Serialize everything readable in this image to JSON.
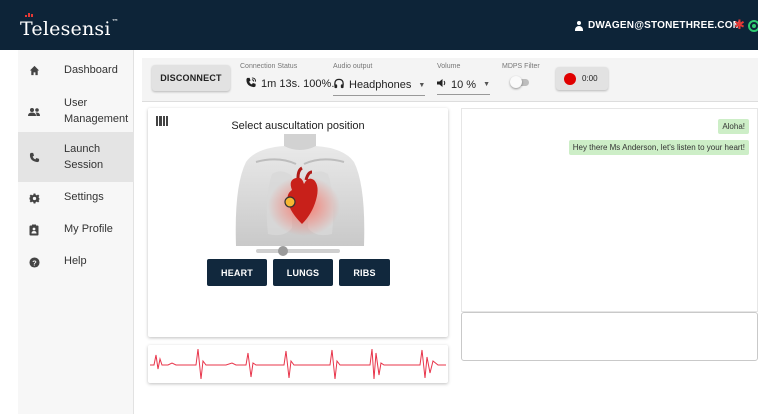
{
  "header": {
    "logo": "Telesensi",
    "trademark": "™",
    "user_email": "DWAGEN@STONETHREE.COM",
    "colors": {
      "bar": "#0d2438",
      "bluetooth": "#e53935",
      "connected": "#2ecc71"
    }
  },
  "sidebar": {
    "items": [
      {
        "label": "Dashboard",
        "icon": "home-icon"
      },
      {
        "label": "User",
        "label2": "Management",
        "icon": "users-icon"
      },
      {
        "label": "Launch",
        "label2": "Session",
        "icon": "phone-icon",
        "active": true
      },
      {
        "label": "Settings",
        "icon": "gear-icon"
      },
      {
        "label": "My Profile",
        "icon": "clipboard-icon"
      },
      {
        "label": "Help",
        "icon": "help-icon"
      }
    ]
  },
  "toolbar": {
    "disconnect_label": "DISCONNECT",
    "connection_status_label": "Connection Status",
    "connection_status_value": "1m 13s. 100%.",
    "audio_output_label": "Audio output",
    "audio_output_value": "Headphones",
    "volume_label": "Volume",
    "volume_value": "10 %",
    "mdps_filter_label": "MDPS Filter",
    "mdps_filter_on": false,
    "record_time": "0:00"
  },
  "auscultation": {
    "title": "Select auscultation position",
    "slider_fraction": 0.3,
    "buttons": [
      "HEART",
      "LUNGS",
      "RIBS"
    ]
  },
  "chat": {
    "messages": [
      "Aloha!",
      "Hey there Ms Anderson, let's listen to your heart!"
    ],
    "bubble_color": "#cdeec7"
  },
  "ecg": {
    "trace_color": "#e8344a"
  }
}
